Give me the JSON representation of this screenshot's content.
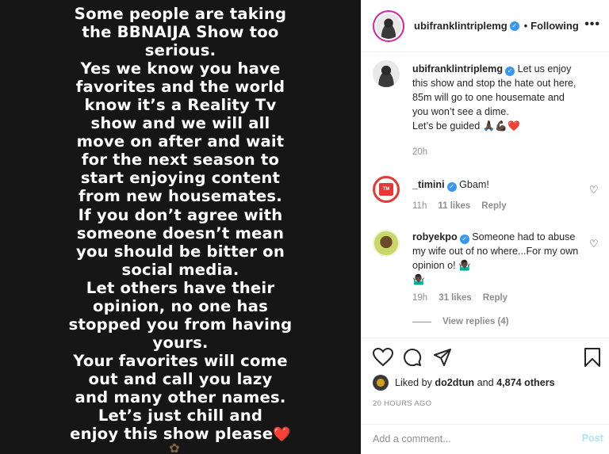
{
  "media": {
    "story_text": "Some people are taking\nthe BBNAIJA Show too\nserious.\nYes we know you have\nfavorites and the world\nknow it’s a Reality Tv\nshow and we will all\nmove on after and wait\nfor the next season to\nstart enjoying content\nfrom new housemates.\nIf you don’t agree with\nsomeone doesn’t mean\nyou should be bitter on\nsocial media.\nLet others have their\nopinion, no one has\nstopped you from having\nyours.\nYour favorites will come\nout and call you lazy\nand many other names.\nLet’s just chill and\nenjoy this show please",
    "end_heart": "❤️"
  },
  "header": {
    "username": "ubifranklintriplemg",
    "follow_status": "Following",
    "more": "•••"
  },
  "caption": {
    "username": "ubifranklintriplemg",
    "text": "Let us enjoy this show and stop the hate out here, 85m will go to one housemate and you won’t see a dime.",
    "text2": "Let’s be guided 🙏🏿💪🏿❤️",
    "time": "20h"
  },
  "comments": [
    {
      "username": "_timini",
      "text": "Gbam!",
      "time": "11h",
      "likes": "11 likes",
      "reply": "Reply"
    },
    {
      "username": "robyekpo",
      "text": "Someone had to abuse my wife out of no where...For my own opinion o! 🤷🏿‍♂️",
      "text2": "🤷🏿‍♂️",
      "time": "19h",
      "likes": "31 likes",
      "reply": "Reply"
    }
  ],
  "view_replies": "View replies (4)",
  "likes": {
    "prefix": "Liked by",
    "user": "do2dtun",
    "middle": "and",
    "count": "4,874 others"
  },
  "post_time": "20 HOURS AGO",
  "add_comment": {
    "placeholder": "Add a comment...",
    "post_label": "Post"
  },
  "icons": [
    "heart-icon",
    "comment-icon",
    "share-icon",
    "bookmark-icon",
    "verified-icon",
    "more-icon"
  ]
}
